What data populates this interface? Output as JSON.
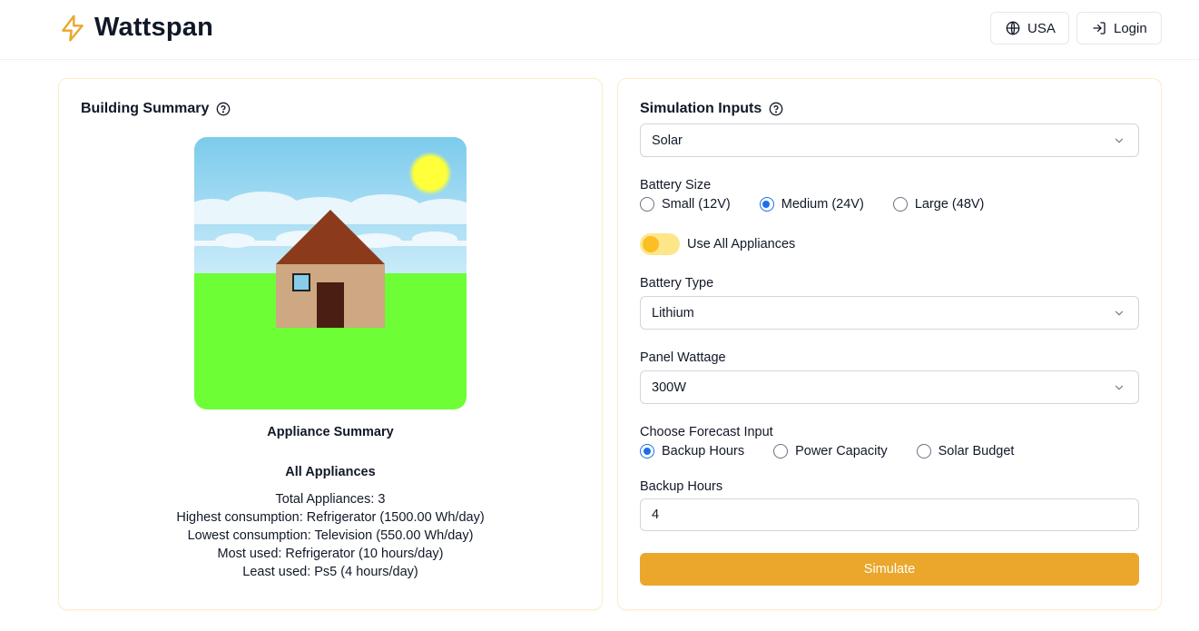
{
  "app": {
    "name": "Wattspan"
  },
  "header": {
    "region_label": "USA",
    "login_label": "Login"
  },
  "building": {
    "title": "Building Summary",
    "appliance_summary_title": "Appliance Summary",
    "subtitle": "All Appliances",
    "lines": [
      "Total Appliances: 3",
      "Highest consumption: Refrigerator (1500.00 Wh/day)",
      "Lowest consumption: Television (550.00 Wh/day)",
      "Most used: Refrigerator (10 hours/day)",
      "Least used: Ps5 (4 hours/day)"
    ]
  },
  "simulation": {
    "title": "Simulation Inputs",
    "source_select": {
      "value": "Solar"
    },
    "battery_size": {
      "label": "Battery Size",
      "options": [
        "Small (12V)",
        "Medium (24V)",
        "Large (48V)"
      ],
      "selected": "Medium (24V)"
    },
    "use_all_appliances": {
      "label": "Use All Appliances",
      "on": true
    },
    "battery_type": {
      "label": "Battery Type",
      "value": "Lithium"
    },
    "panel_wattage": {
      "label": "Panel Wattage",
      "value": "300W"
    },
    "forecast_input": {
      "label": "Choose Forecast Input",
      "options": [
        "Backup Hours",
        "Power Capacity",
        "Solar Budget"
      ],
      "selected": "Backup Hours"
    },
    "backup_hours": {
      "label": "Backup Hours",
      "value": "4"
    },
    "simulate_label": "Simulate"
  },
  "colors": {
    "accent": "#eaa72c",
    "card_border": "#fcefc4",
    "radio_selected": "#1d6fe8",
    "sky": "#87cdea",
    "grass": "#6dfe35",
    "sun": "#ffff3a",
    "roof": "#8b3b1b",
    "wall": "#cda882",
    "door": "#4a1e12"
  },
  "icons": {
    "logo": "lightning-bolt-icon",
    "region": "globe-icon",
    "login": "log-in-icon",
    "help": "help-circle-icon",
    "select": "chevron-down-icon"
  }
}
